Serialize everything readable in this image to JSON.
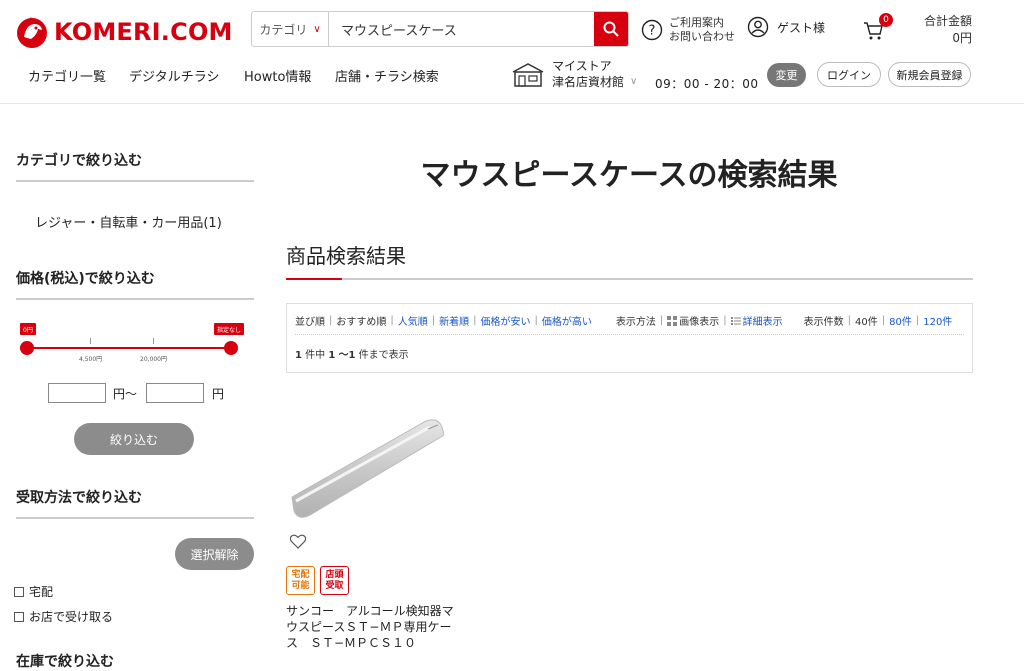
{
  "brand": {
    "name": "KOMERI.COM",
    "color": "#d7000f"
  },
  "search": {
    "category_label": "カテゴリ",
    "query": "マウスピースケース"
  },
  "header": {
    "help_line1": "ご利用案内",
    "help_line2": "お問い合わせ",
    "guest_label": "ゲスト様",
    "cart_count": "0",
    "total_label": "合計金額",
    "total_value": "0円"
  },
  "nav": {
    "items": [
      "カテゴリ一覧",
      "デジタルチラシ",
      "Howto情報",
      "店舗・チラシ検索"
    ],
    "store_label": "マイストア",
    "store_name": "津名店資材館",
    "store_hours": "09：00 - 20：00",
    "change_label": "変更",
    "login_label": "ログイン",
    "register_label": "新規会員登録"
  },
  "sidebar": {
    "category_heading": "カテゴリで絞り込む",
    "category_item": "レジャー・自転車・カー用品(1)",
    "price_heading": "価格(税込)で絞り込む",
    "price_min_flag": "0円",
    "price_max_flag": "指定なし",
    "price_tick1": "4,500円",
    "price_tick2": "20,000円",
    "price_unit_mid": "円〜",
    "price_unit_end": "円",
    "narrow_button": "絞り込む",
    "pickup_heading": "受取方法で絞り込む",
    "clear_button": "選択解除",
    "pickup_options": [
      "宅配",
      "お店で受け取る"
    ],
    "stock_heading": "在庫で絞り込む"
  },
  "main": {
    "page_title": "マウスピースケースの検索結果",
    "section_title": "商品検索結果",
    "sort_label": "並び順",
    "sort_options": [
      "おすすめ順",
      "人気順",
      "新着順",
      "価格が安い",
      "価格が高い"
    ],
    "view_label": "表示方法",
    "view_image": "画像表示",
    "view_detail": "詳細表示",
    "count_label": "表示件数",
    "count_options": [
      "40件",
      "80件",
      "120件"
    ],
    "result_total": "1",
    "result_from": "1",
    "result_to": "1",
    "result_text_a": "件中",
    "result_text_b": "〜",
    "result_text_c": "件まで表示"
  },
  "product": {
    "badge1": [
      "宅配",
      "可能"
    ],
    "badge2": [
      "店頭",
      "受取"
    ],
    "name": "サンコー　アルコール検知器マウスピースＳＴ−ＭＰ専用ケース　ＳＴ−ＭＰＣＳ１０"
  }
}
